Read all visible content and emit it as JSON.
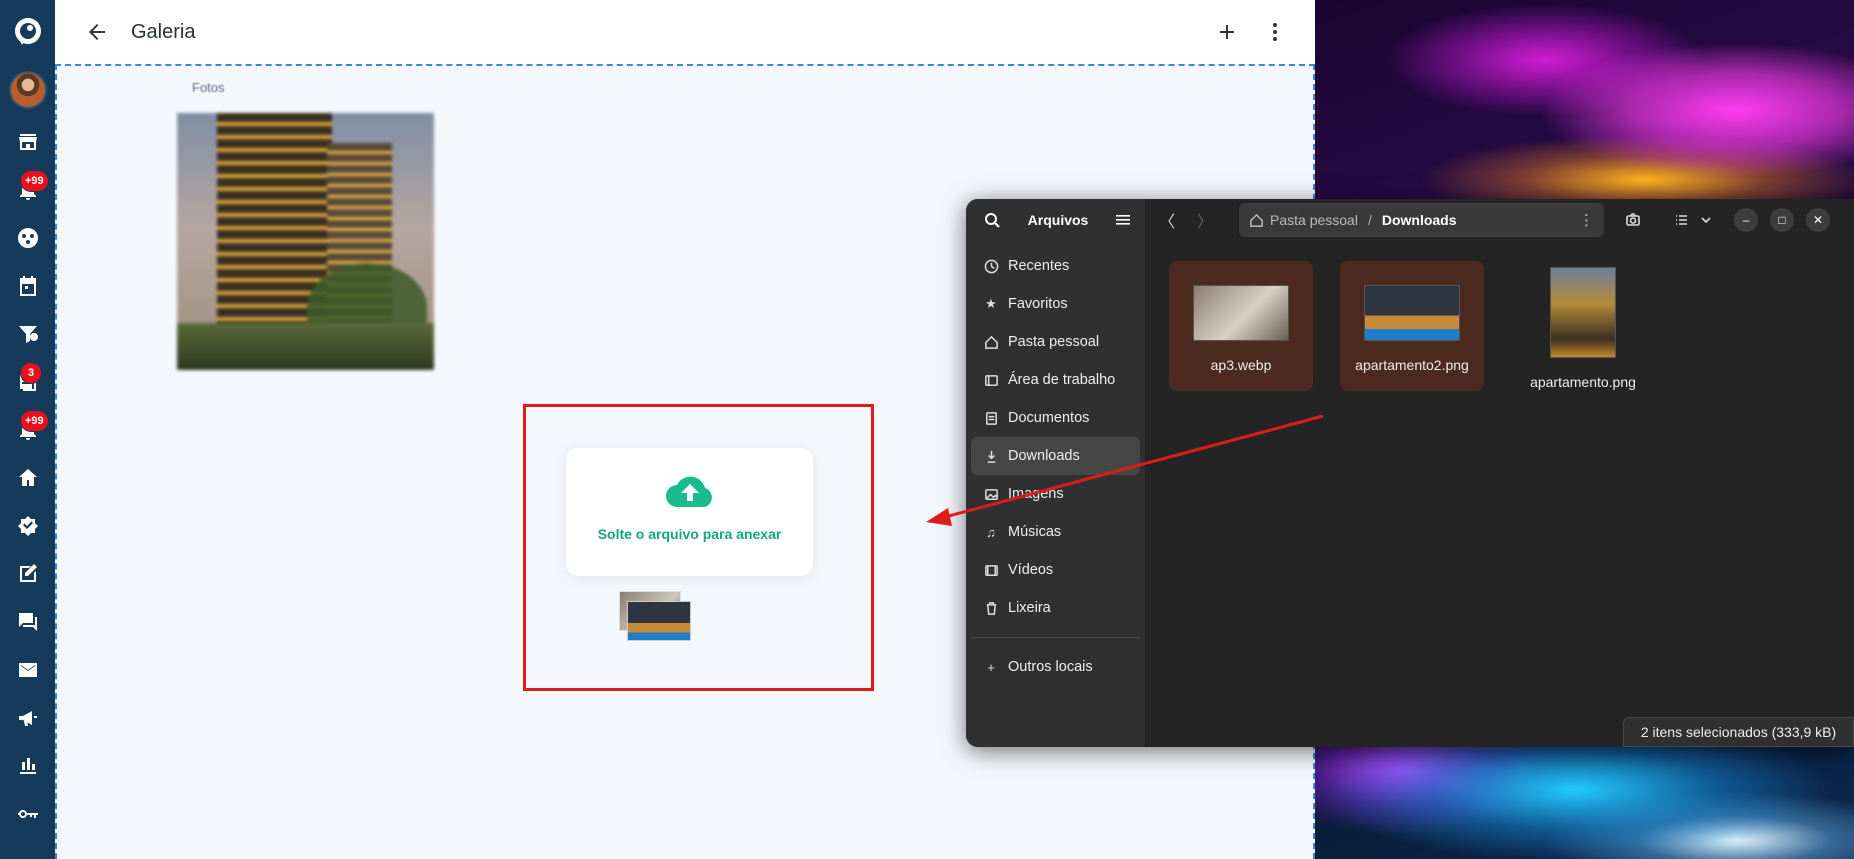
{
  "app": {
    "title": "Galeria",
    "section_label": "Fotos",
    "drop_message": "Solte o arquivo para anexar"
  },
  "rail": {
    "badges": [
      "+99",
      "3",
      "+99"
    ]
  },
  "file_manager": {
    "app_title": "Arquivos",
    "places": [
      {
        "label": "Recentes",
        "icon": "clock-icon"
      },
      {
        "label": "Favoritos",
        "icon": "star-icon"
      },
      {
        "label": "Pasta pessoal",
        "icon": "home-icon"
      },
      {
        "label": "Área de trabalho",
        "icon": "desktop-icon"
      },
      {
        "label": "Documentos",
        "icon": "document-icon"
      },
      {
        "label": "Downloads",
        "icon": "download-icon"
      },
      {
        "label": "Imagens",
        "icon": "image-icon"
      },
      {
        "label": "Músicas",
        "icon": "music-icon"
      },
      {
        "label": "Vídeos",
        "icon": "video-icon"
      },
      {
        "label": "Lixeira",
        "icon": "trash-icon"
      }
    ],
    "other_locations": "Outros locais",
    "path": {
      "home": "Pasta pessoal",
      "current": "Downloads"
    },
    "files": [
      {
        "name": "ap3.webp",
        "selected": true
      },
      {
        "name": "apartamento2.png",
        "selected": true
      },
      {
        "name": "apartamento.png",
        "selected": false
      }
    ],
    "status": "2 itens selecionados  (333,9 kB)"
  },
  "colors": {
    "rail": "#153a5a",
    "accent_green": "#17a77c",
    "highlight_red": "#e01b1b",
    "selection": "#4d2a1f",
    "badge": "#e8101c"
  }
}
